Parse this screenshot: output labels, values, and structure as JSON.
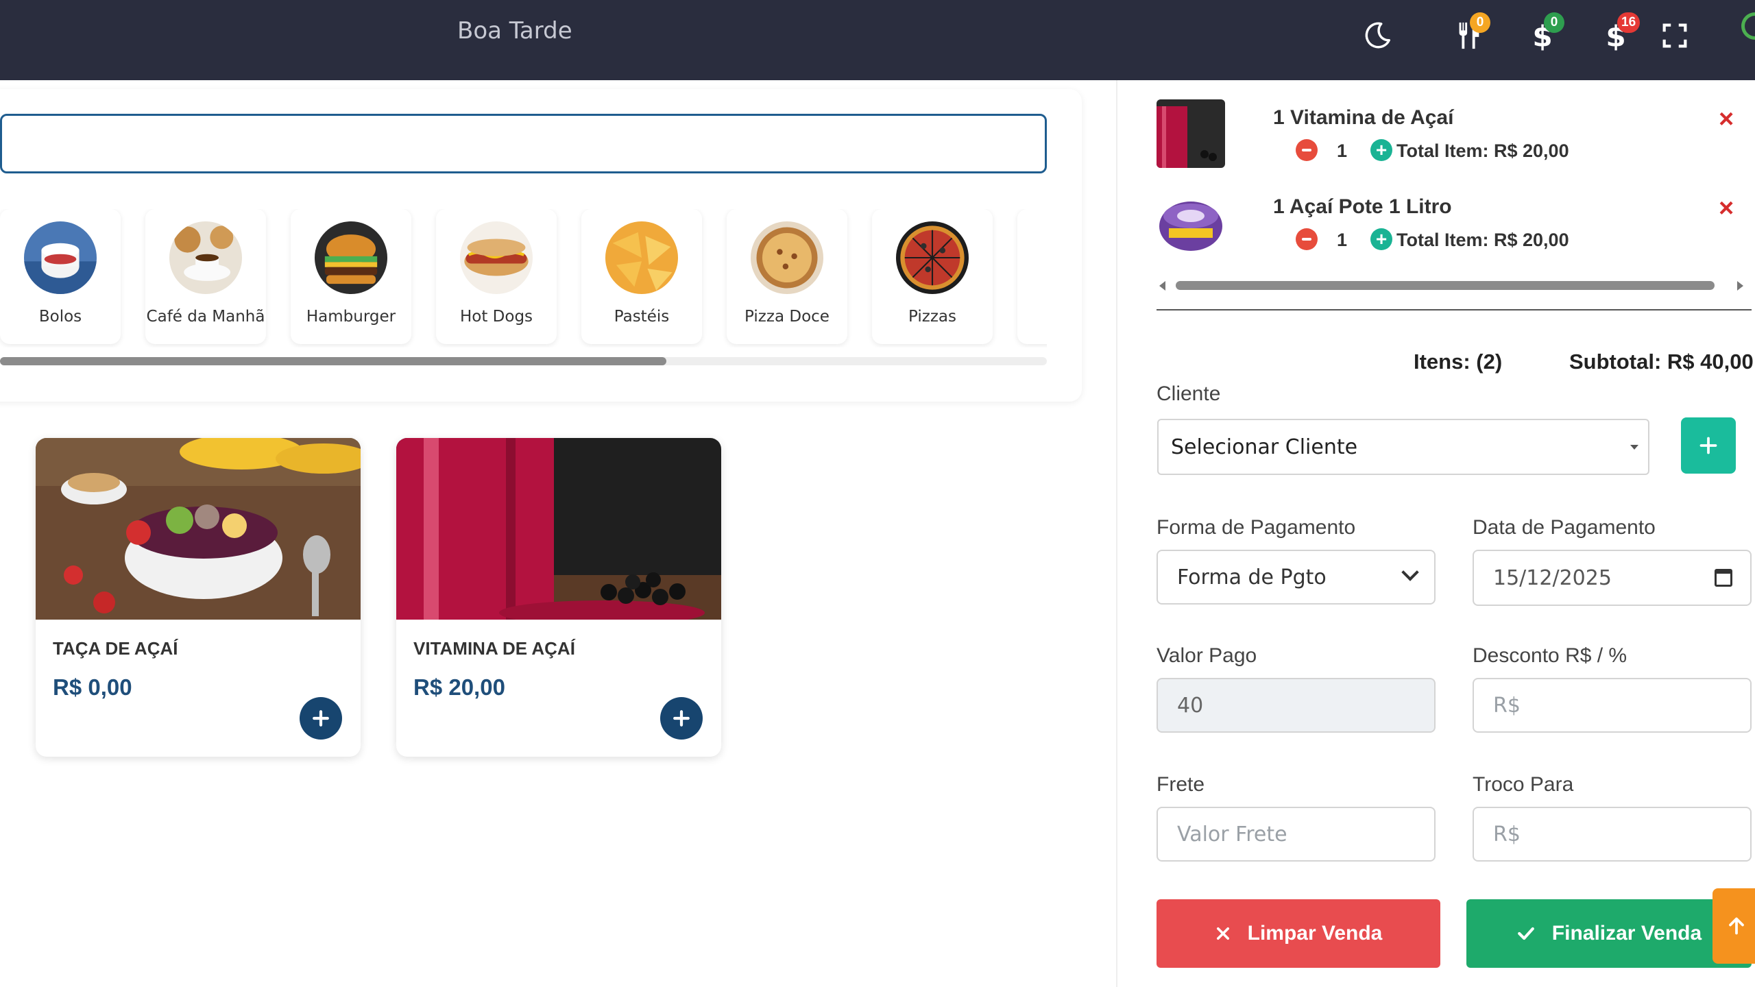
{
  "header": {
    "greeting": "Boa Tarde",
    "badges": {
      "orders": "0",
      "payments": "0",
      "pending": "16"
    },
    "colors": {
      "bar": "#2a2d3e",
      "badge_orange": "#f5a623",
      "badge_green": "#2e9e4f",
      "badge_red": "#e53935"
    },
    "icons": [
      "moon-icon",
      "utensils-icon",
      "dollar-icon",
      "dollar-icon",
      "fullscreen-icon"
    ]
  },
  "search": {
    "placeholder": "",
    "value": ""
  },
  "categories": [
    {
      "label": "Bolos"
    },
    {
      "label": "Café da Manhã"
    },
    {
      "label": "Hamburger"
    },
    {
      "label": "Hot Dogs"
    },
    {
      "label": "Pastéis"
    },
    {
      "label": "Pizza Doce"
    },
    {
      "label": "Pizzas"
    }
  ],
  "products": [
    {
      "name": "TAÇA DE AÇAÍ",
      "price": "R$ 0,00"
    },
    {
      "name": "VITAMINA DE AÇAÍ",
      "price": "R$ 20,00"
    }
  ],
  "cart": {
    "items": [
      {
        "name": "1 Vitamina de Açaí",
        "qty": "1",
        "total": "Total Item: R$ 20,00"
      },
      {
        "name": "1 Açaí Pote 1 Litro",
        "qty": "1",
        "total": "Total Item: R$ 20,00"
      }
    ],
    "items_label": "Itens: (2)",
    "subtotal_label": "Subtotal: R$ 40,00"
  },
  "form": {
    "cliente_label": "Cliente",
    "cliente_value": "Selecionar Cliente",
    "forma_pagamento_label": "Forma de Pagamento",
    "forma_pagamento_value": "Forma de Pgto",
    "data_pagamento_label": "Data de Pagamento",
    "data_pagamento_value": "15/12/2025",
    "valor_pago_label": "Valor Pago",
    "valor_pago_value": "40",
    "desconto_label": "Desconto R$ / %",
    "desconto_placeholder": "R$",
    "frete_label": "Frete",
    "frete_placeholder": "Valor Frete",
    "troco_label": "Troco Para",
    "troco_placeholder": "R$"
  },
  "actions": {
    "clear_label": "Limpar Venda",
    "finish_label": "Finalizar Venda"
  },
  "theme": {
    "primary_blue": "#1f4e7a",
    "add_green": "#1abc9c",
    "clear_red": "#e84c4f",
    "finish_green": "#1eaa6b",
    "scroll_top_orange": "#f5921e"
  }
}
